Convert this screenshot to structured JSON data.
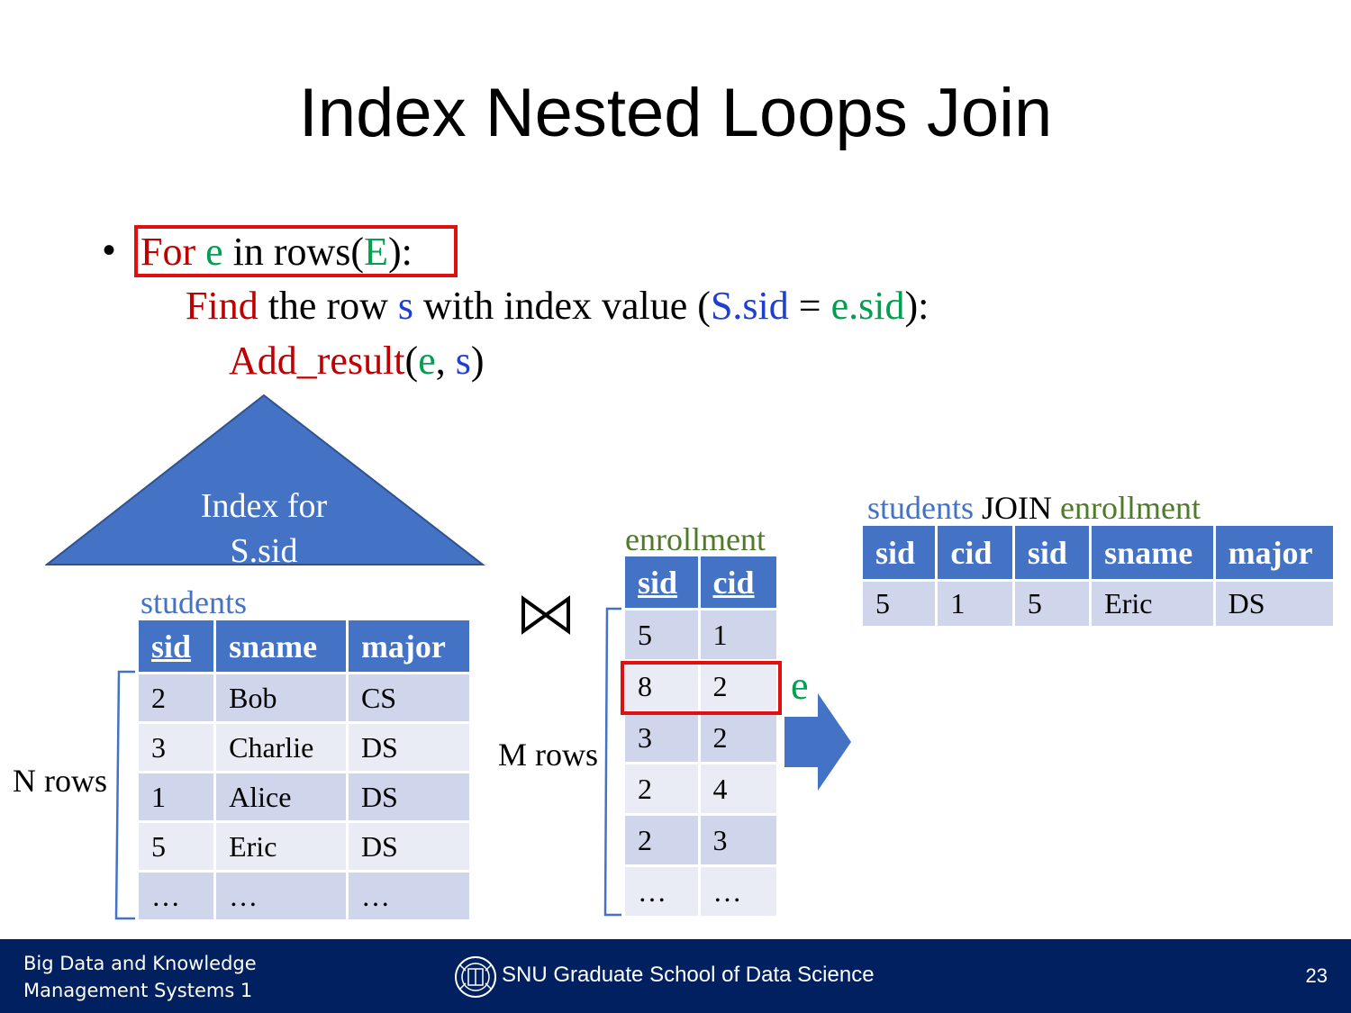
{
  "slide": {
    "title": "Index Nested Loops Join",
    "page_number": "23"
  },
  "code": {
    "line1": {
      "bullet": "•",
      "for": "For",
      "e": "e",
      "in_rows": "in rows(",
      "E": "E",
      "close": "):"
    },
    "line2": {
      "find": "Find",
      "the_row": "the row",
      "s": "s",
      "with_index": "with index value (",
      "S_sid": "S.sid",
      "eq": "=",
      "e_sid": "e.sid",
      "close": "):"
    },
    "line3": {
      "add_result": "Add_result",
      "open": "(",
      "e": "e",
      "comma": ",",
      "s": "s",
      "close": ")"
    }
  },
  "index_triangle": {
    "line1": "Index for",
    "line2": "S.sid"
  },
  "students": {
    "label": "students",
    "headers": [
      "sid",
      "sname",
      "major"
    ],
    "rows": [
      [
        "2",
        "Bob",
        "CS"
      ],
      [
        "3",
        "Charlie",
        "DS"
      ],
      [
        "1",
        "Alice",
        "DS"
      ],
      [
        "5",
        "Eric",
        "DS"
      ],
      [
        "…",
        "…",
        "…"
      ]
    ],
    "count_label": "N rows"
  },
  "join_symbol": "⋈",
  "enrollment": {
    "label": "enrollment",
    "headers": [
      "sid",
      "cid"
    ],
    "rows": [
      [
        "5",
        "1"
      ],
      [
        "8",
        "2"
      ],
      [
        "3",
        "2"
      ],
      [
        "2",
        "4"
      ],
      [
        "2",
        "3"
      ],
      [
        "…",
        "…"
      ]
    ],
    "count_label": "M rows",
    "highlight_label": "e"
  },
  "result": {
    "label_left": "students",
    "label_mid": "JOIN",
    "label_right": "enrollment",
    "headers": [
      "sid",
      "cid",
      "sid",
      "sname",
      "major"
    ],
    "rows": [
      [
        "5",
        "1",
        "5",
        "Eric",
        "DS"
      ]
    ]
  },
  "colors": {
    "red": "#c00000",
    "green": "#00a050",
    "blue": "#1f3fd0",
    "table_header": "#4472c4",
    "footer_bg": "#002060"
  },
  "footer": {
    "left_line1": "Big Data and Knowledge",
    "left_line2": "Management Systems 1",
    "center": "SNU Graduate School of Data Science",
    "logo": "snu-logo-icon"
  }
}
